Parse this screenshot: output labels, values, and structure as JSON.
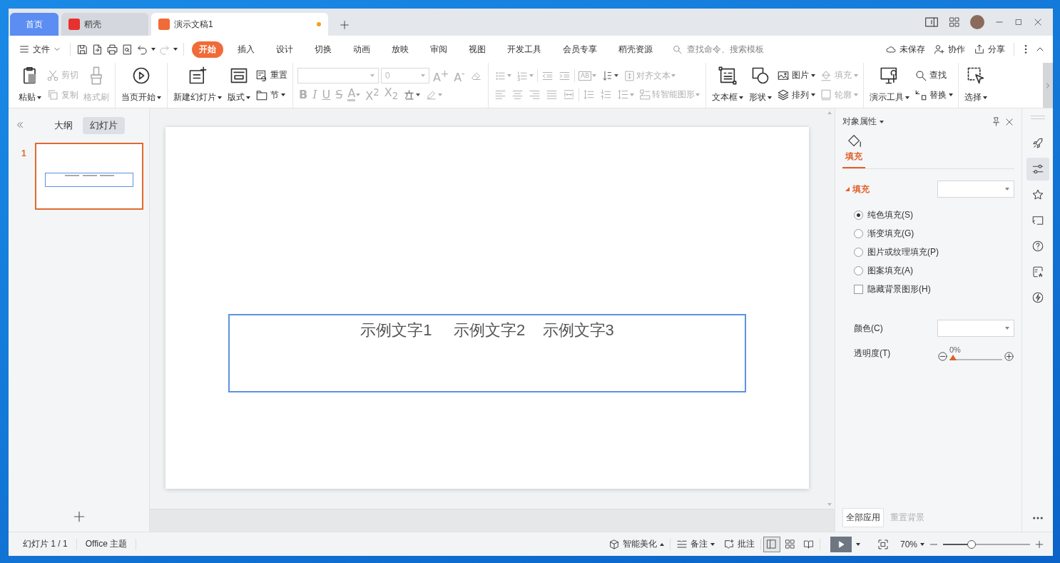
{
  "window_tabs": [
    {
      "label": "首页",
      "kind": "home",
      "selected": false
    },
    {
      "label": "稻壳",
      "kind": "docer",
      "selected": false
    },
    {
      "label": "演示文稿1",
      "kind": "document",
      "selected": true,
      "unsaved": true
    }
  ],
  "menu": {
    "file": "文件",
    "tabs": [
      {
        "label": "开始",
        "selected": true
      },
      {
        "label": "插入",
        "selected": false
      },
      {
        "label": "设计",
        "selected": false
      },
      {
        "label": "切换",
        "selected": false
      },
      {
        "label": "动画",
        "selected": false
      },
      {
        "label": "放映",
        "selected": false
      },
      {
        "label": "审阅",
        "selected": false
      },
      {
        "label": "视图",
        "selected": false
      },
      {
        "label": "开发工具",
        "selected": false
      },
      {
        "label": "会员专享",
        "selected": false
      },
      {
        "label": "稻壳资源",
        "selected": false
      }
    ],
    "search": {
      "placeholder": "查找命令、搜索模板"
    },
    "actions": [
      {
        "label": "未保存",
        "kind": "cloud"
      },
      {
        "label": "协作",
        "kind": "collab"
      },
      {
        "label": "分享",
        "kind": "share"
      }
    ]
  },
  "ribbon": [
    {
      "columns": [
        [
          {
            "kind": "paste",
            "label": "粘贴",
            "dropdown": true,
            "disabled": false
          }
        ],
        [
          {
            "kind": "cut",
            "label": "剪切",
            "dropdown": false,
            "disabled": true
          },
          {
            "kind": "copy",
            "label": "复制",
            "dropdown": false,
            "disabled": true
          }
        ],
        [
          {
            "kind": "brush",
            "label": "格式刷",
            "dropdown": false,
            "disabled": true
          }
        ]
      ]
    },
    {
      "columns": [
        [
          {
            "kind": "play",
            "label": "当页开始",
            "dropdown": true,
            "disabled": false
          }
        ]
      ]
    },
    {
      "columns": [
        [
          {
            "kind": "new-slide",
            "label": "新建幻灯片",
            "dropdown": true,
            "disabled": false
          }
        ],
        [
          {
            "kind": "layout",
            "label": "版式",
            "dropdown": true,
            "disabled": false
          }
        ],
        [
          {
            "kind": "reset",
            "label": "重置",
            "dropdown": false,
            "disabled": false
          },
          {
            "kind": "section",
            "label": "节",
            "dropdown": true,
            "disabled": false
          }
        ]
      ]
    },
    {
      "strips": [
        {
          "tools": [
            {
              "kind": "font-name",
              "dropdown": true,
              "disabled": true
            },
            {
              "kind": "font-size",
              "value": "0",
              "dropdown": true,
              "disabled": true
            },
            {
              "kind": "grow",
              "glyph": "A$^{+}$",
              "dropdown": false,
              "disabled": true
            },
            {
              "kind": "shrink",
              "glyph": "A$^{-}$",
              "dropdown": false,
              "disabled": true
            },
            {
              "kind": "eraser",
              "dropdown": false,
              "disabled": true
            }
          ]
        },
        {
          "tools": [
            {
              "kind": "bold",
              "glyph": "B",
              "dropdown": false,
              "disabled": true
            },
            {
              "kind": "italic",
              "glyph": "I",
              "dropdown": false,
              "disabled": true
            },
            {
              "kind": "underline",
              "glyph": "U",
              "dropdown": false,
              "disabled": true
            },
            {
              "kind": "strike",
              "glyph": "S",
              "dropdown": false,
              "disabled": true
            },
            {
              "kind": "font-color",
              "glyph": "A",
              "dropdown": true,
              "disabled": true
            },
            {
              "kind": "superscript",
              "glyph": "X$^{2}$",
              "dropdown": false,
              "disabled": true
            },
            {
              "kind": "subscript",
              "glyph": "X$_{2}$",
              "dropdown": false,
              "disabled": true
            },
            {
              "kind": "pinyin",
              "dropdown": true,
              "disabled": false
            },
            {
              "kind": "highlight",
              "dropdown": true,
              "disabled": true
            }
          ]
        }
      ]
    },
    {
      "strips": [
        {
          "tools": [
            {
              "kind": "bullets",
              "dropdown": true,
              "disabled": true
            },
            {
              "kind": "numbering",
              "dropdown": true,
              "disabled": true
            },
            {
              "kind": "separator"
            },
            {
              "kind": "outdent",
              "dropdown": false,
              "disabled": true
            },
            {
              "kind": "indent",
              "dropdown": false,
              "disabled": true
            },
            {
              "kind": "separator"
            },
            {
              "kind": "text-direction",
              "glyph": "AB",
              "dropdown": true,
              "disabled": true
            },
            {
              "kind": "sort",
              "dropdown": true,
              "disabled": false
            },
            {
              "kind": "align-text",
              "label": "对齐文本",
              "dropdown": true,
              "disabled": true
            }
          ]
        },
        {
          "tools": [
            {
              "kind": "align-left",
              "dropdown": false,
              "disabled": true
            },
            {
              "kind": "align-center",
              "dropdown": false,
              "disabled": true
            },
            {
              "kind": "align-right",
              "dropdown": false,
              "disabled": true
            },
            {
              "kind": "justify",
              "dropdown": false,
              "disabled": true
            },
            {
              "kind": "distribute",
              "dropdown": false,
              "disabled": true
            },
            {
              "kind": "separator"
            },
            {
              "kind": "line-spacing",
              "dropdown": false,
              "disabled": true
            },
            {
              "kind": "para-spacing",
              "dropdown": false,
              "disabled": true
            },
            {
              "kind": "spacing",
              "dropdown": true,
              "disabled": true
            },
            {
              "kind": "smartart",
              "label": "转智能图形",
              "dropdown": true,
              "disabled": true
            }
          ]
        }
      ]
    },
    {
      "columns": [
        [
          {
            "kind": "textbox",
            "label": "文本框",
            "dropdown": true,
            "disabled": false
          }
        ],
        [
          {
            "kind": "shape",
            "label": "形状",
            "dropdown": true,
            "disabled": false
          }
        ],
        [
          {
            "kind": "picture",
            "label": "图片",
            "dropdown": true,
            "disabled": false
          },
          {
            "kind": "arrange",
            "label": "排列",
            "dropdown": true,
            "disabled": false
          }
        ],
        [
          {
            "kind": "fill",
            "label": "填充",
            "dropdown": true,
            "disabled": true
          },
          {
            "kind": "outline",
            "label": "轮廓",
            "dropdown": true,
            "disabled": true
          }
        ]
      ]
    },
    {
      "columns": [
        [
          {
            "kind": "tools",
            "label": "演示工具",
            "dropdown": true,
            "disabled": false
          }
        ],
        [
          {
            "kind": "find",
            "label": "查找",
            "dropdown": false,
            "disabled": false
          },
          {
            "kind": "replace",
            "label": "替换",
            "dropdown": true,
            "disabled": false
          }
        ]
      ]
    },
    {
      "columns": [
        [
          {
            "kind": "select",
            "label": "选择",
            "dropdown": true,
            "disabled": false
          }
        ]
      ]
    }
  ],
  "left_panel": {
    "tabs": [
      {
        "label": "大纲",
        "selected": false
      },
      {
        "label": "幻灯片",
        "selected": true
      }
    ],
    "slides": [
      {
        "number": "1",
        "selected": true
      }
    ]
  },
  "slide": {
    "textbox": {
      "text": "示例文字1     示例文字2    示例文字3",
      "selected": true
    }
  },
  "properties": {
    "title": "对象属性",
    "tabs": [
      {
        "label": "填充",
        "selected": true
      }
    ],
    "section": {
      "label": "填充",
      "expanded": true
    },
    "options": [
      {
        "kind": "radio",
        "label": "纯色填充(S)",
        "selected": true
      },
      {
        "kind": "radio",
        "label": "渐变填充(G)",
        "selected": false
      },
      {
        "kind": "radio",
        "label": "图片或纹理填充(P)",
        "selected": false
      },
      {
        "kind": "radio",
        "label": "图案填充(A)",
        "selected": false
      },
      {
        "kind": "checkbox",
        "label": "隐藏背景图形(H)",
        "checked": false
      }
    ],
    "color_label": "颜色(C)",
    "transparency": {
      "label": "透明度(T)",
      "level": 0,
      "reading": "0%"
    },
    "buttons": [
      {
        "label": "全部应用",
        "disabled": false
      },
      {
        "label": "重置背景",
        "disabled": true
      }
    ]
  },
  "sidebar": [
    {
      "kind": "rocket",
      "selected": false
    },
    {
      "kind": "sliders",
      "selected": true
    },
    {
      "kind": "star",
      "selected": false
    },
    {
      "kind": "slideshow",
      "selected": false
    },
    {
      "kind": "help",
      "selected": false
    },
    {
      "kind": "image",
      "selected": false
    },
    {
      "kind": "bolt",
      "selected": false
    }
  ],
  "status_bar": {
    "slide_info": "幻灯片 1 / 1",
    "theme": "Office 主题",
    "beautify": "智能美化",
    "notes": "备注",
    "comments": "批注",
    "views": [
      {
        "kind": "normal",
        "selected": true
      },
      {
        "kind": "sorter",
        "selected": false
      },
      {
        "kind": "reading",
        "selected": false
      }
    ],
    "zoom": "70%",
    "zoom_slider": {
      "level": 0.33
    }
  }
}
